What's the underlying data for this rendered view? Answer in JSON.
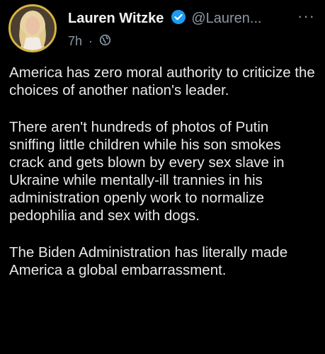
{
  "author": {
    "name": "Lauren Witzke",
    "handle": "@Lauren...",
    "verified_icon": "verified-badge-icon",
    "avatar": "profile-photo"
  },
  "meta": {
    "time": "7h",
    "separator": "·",
    "audience_icon": "globe-icon"
  },
  "more_icon": "more-options-icon",
  "more_label": "···",
  "paragraphs": [
    "America has zero moral authority to criticize the choices of another nation's leader.",
    "There aren't hundreds of photos of Putin sniffing little children while his son smokes crack and gets blown by every sex slave in Ukraine while mentally-ill trannies in his administration openly work to normalize pedophilia and sex with dogs.",
    "The Biden Administration has literally made America a global embarrassment."
  ],
  "colors": {
    "background": "#000000",
    "text": "#e7e9ea",
    "secondary": "#8b98a5",
    "verified": "#1d9bf0",
    "avatar_ring": "#d8b441"
  }
}
